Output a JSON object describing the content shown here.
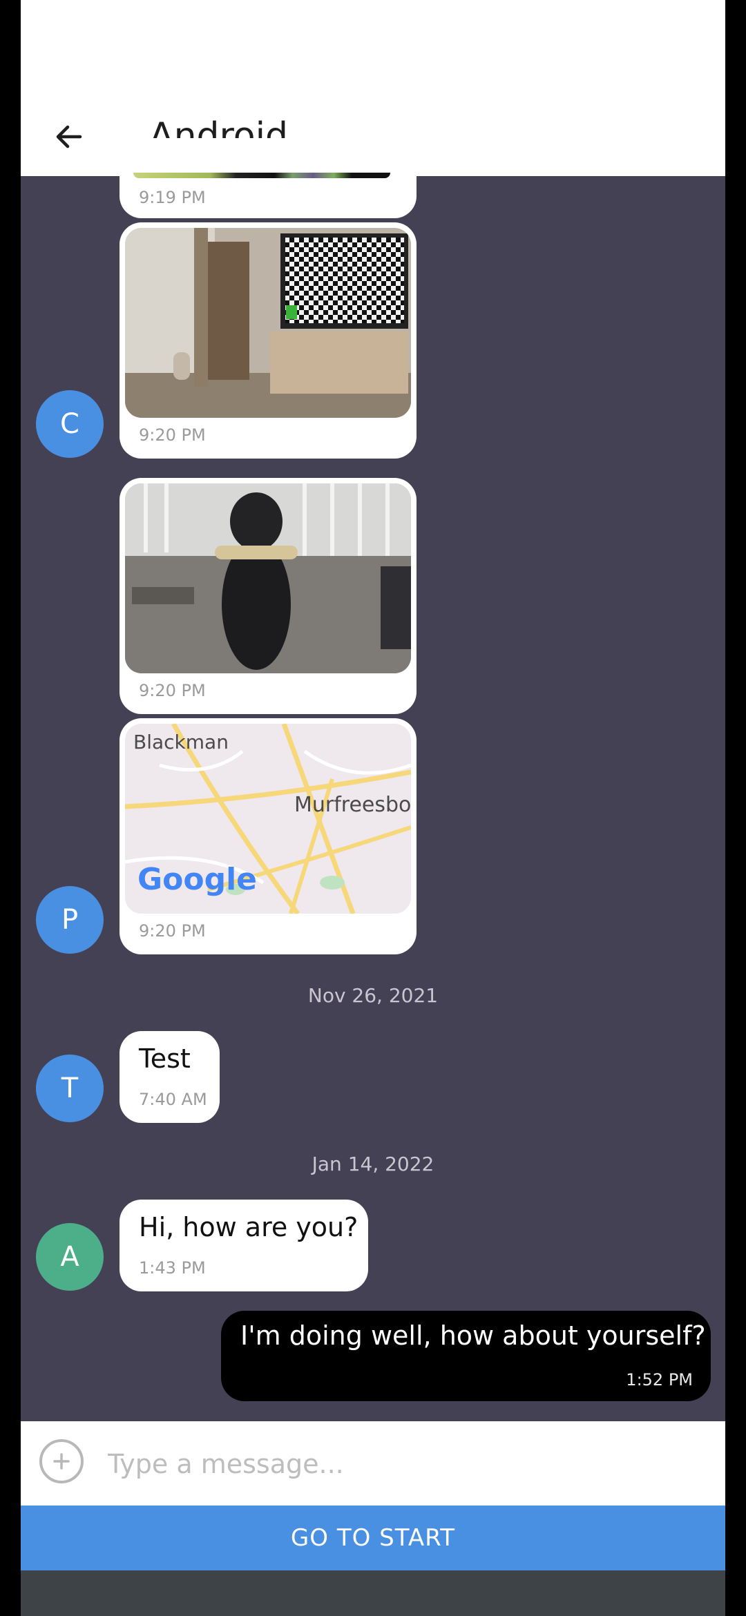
{
  "header": {
    "title": "Android",
    "back_icon": "arrow-left-icon"
  },
  "messages": [
    {
      "time": "9:19 PM"
    },
    {
      "time": "9:20 PM",
      "image": "photo-tv-checkerboard"
    },
    {
      "time": "9:20 PM",
      "image": "photo-dog"
    },
    {
      "time": "9:20 PM",
      "map_labels": [
        "Blackman",
        "Murfreesbor",
        "Google"
      ]
    },
    {
      "time": "7:40 AM",
      "text": "Test"
    },
    {
      "time": "1:43 PM",
      "text": "Hi, how are you?"
    },
    {
      "time": "1:52 PM",
      "text": "I'm doing well, how about yourself?"
    }
  ],
  "avatars": [
    {
      "letter": "C",
      "color": "#4a90e2"
    },
    {
      "letter": "P",
      "color": "#4a90e2"
    },
    {
      "letter": "T",
      "color": "#4a90e2"
    },
    {
      "letter": "A",
      "color": "#4caf8a"
    }
  ],
  "date_separators": [
    "Nov 26, 2021",
    "Jan 14, 2022"
  ],
  "composer": {
    "placeholder": "Type a message...",
    "add_icon": "plus-circle-icon"
  },
  "go_to_start": {
    "label": "GO TO START"
  },
  "colors": {
    "chat_bg": "#454155",
    "accent": "#4a90e2",
    "outgoing_bubble": "#000000"
  }
}
